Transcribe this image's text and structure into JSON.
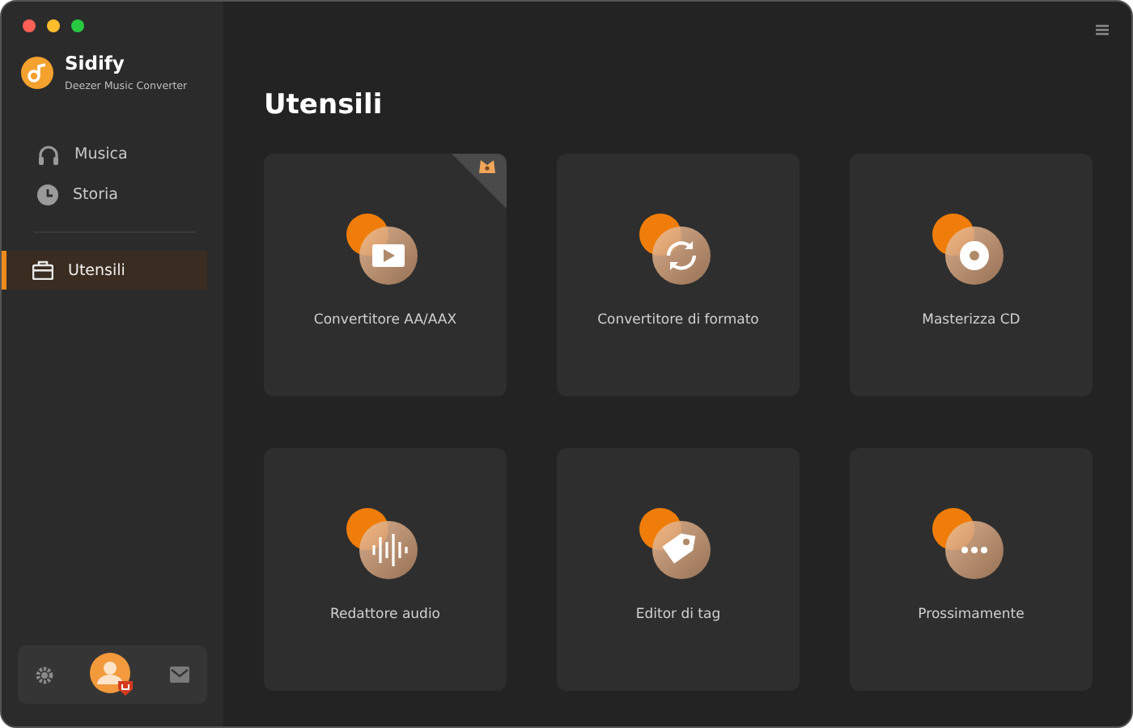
{
  "app": {
    "name": "Sidify",
    "subtitle": "Deezer Music Converter"
  },
  "nav": [
    {
      "label": "Musica",
      "kind": "headphones",
      "selected": false
    },
    {
      "label": "Storia",
      "kind": "clock",
      "selected": false
    },
    {
      "label": "Utensili",
      "kind": "toolbox",
      "selected": true
    }
  ],
  "page_title": "Utensili",
  "tools": [
    {
      "label": "Convertitore AA/AAX",
      "kind": "video",
      "premium": true
    },
    {
      "label": "Convertitore di formato",
      "kind": "convert",
      "premium": false
    },
    {
      "label": "Masterizza CD",
      "kind": "disc",
      "premium": false
    },
    {
      "label": "Redattore audio",
      "kind": "wave",
      "premium": false
    },
    {
      "label": "Editor di tag",
      "kind": "tag",
      "premium": false
    },
    {
      "label": "Prossimamente",
      "kind": "more",
      "premium": false
    }
  ]
}
